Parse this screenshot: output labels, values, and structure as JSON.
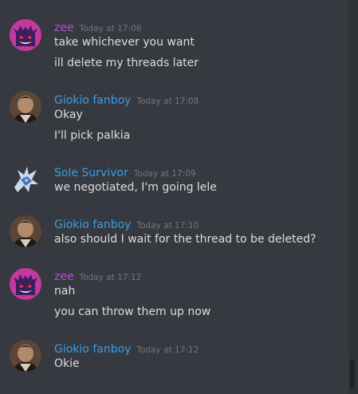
{
  "colors": {
    "background": "#36393f",
    "purple_user": "#b24fd6",
    "blue_user": "#3a9de4",
    "timestamp": "#72767d",
    "text": "#dcddde",
    "scrollbar_track": "#2e3338",
    "scrollbar_thumb": "#202225"
  },
  "messages": [
    {
      "username": "zee",
      "timestamp": "Today at 17:06",
      "avatar_icon": "gengar-avatar-icon",
      "lines": [
        "take whichever you want",
        "ill delete my threads later"
      ]
    },
    {
      "username": "Giokio fanboy",
      "timestamp": "Today at 17:08",
      "avatar_icon": "giokio-avatar-icon",
      "lines": [
        "Okay",
        "I'll pick palkia"
      ]
    },
    {
      "username": "Sole Survivor",
      "timestamp": "Today at 17:09",
      "avatar_icon": "dialga-avatar-icon",
      "lines": [
        "we negotiated, I'm going lele"
      ]
    },
    {
      "username": "Giokio fanboy",
      "timestamp": "Today at 17:10",
      "avatar_icon": "giokio-avatar-icon",
      "lines": [
        "also should I wait for the thread to be deleted?"
      ]
    },
    {
      "username": "zee",
      "timestamp": "Today at 17:12",
      "avatar_icon": "gengar-avatar-icon",
      "lines": [
        "nah",
        "you can throw them up now"
      ]
    },
    {
      "username": "Giokio fanboy",
      "timestamp": "Today at 17:12",
      "avatar_icon": "giokio-avatar-icon",
      "lines": [
        "Okie"
      ]
    }
  ]
}
